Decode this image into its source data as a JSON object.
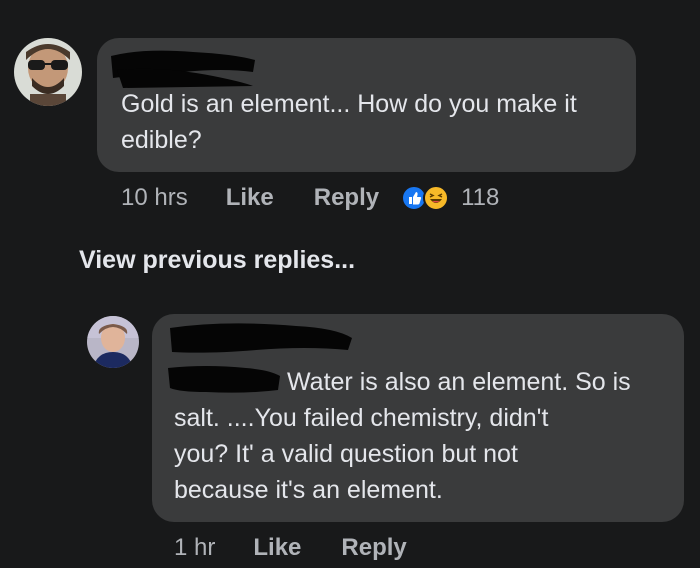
{
  "comment1": {
    "text": "Gold is an element... How do you make it\nedible?",
    "time": "10 hrs",
    "like_label": "Like",
    "reply_label": "Reply",
    "reaction_count": "118",
    "reactions": [
      "like-icon",
      "haha-icon"
    ]
  },
  "view_previous_label": "View previous replies...",
  "comment2": {
    "line1": "Water is also an element.  So is",
    "rest": "salt.   ....You failed chemistry, didn't\nyou?   It' a valid question but not\nbecause it's an element.",
    "time": "1 hr",
    "like_label": "Like",
    "reply_label": "Reply"
  },
  "colors": {
    "background": "#18191a",
    "bubble": "#3a3b3c",
    "text": "#e4e6eb",
    "meta": "#b0b3b8",
    "like_blue": "#1877f2",
    "haha_yellow": "#f7b928"
  }
}
